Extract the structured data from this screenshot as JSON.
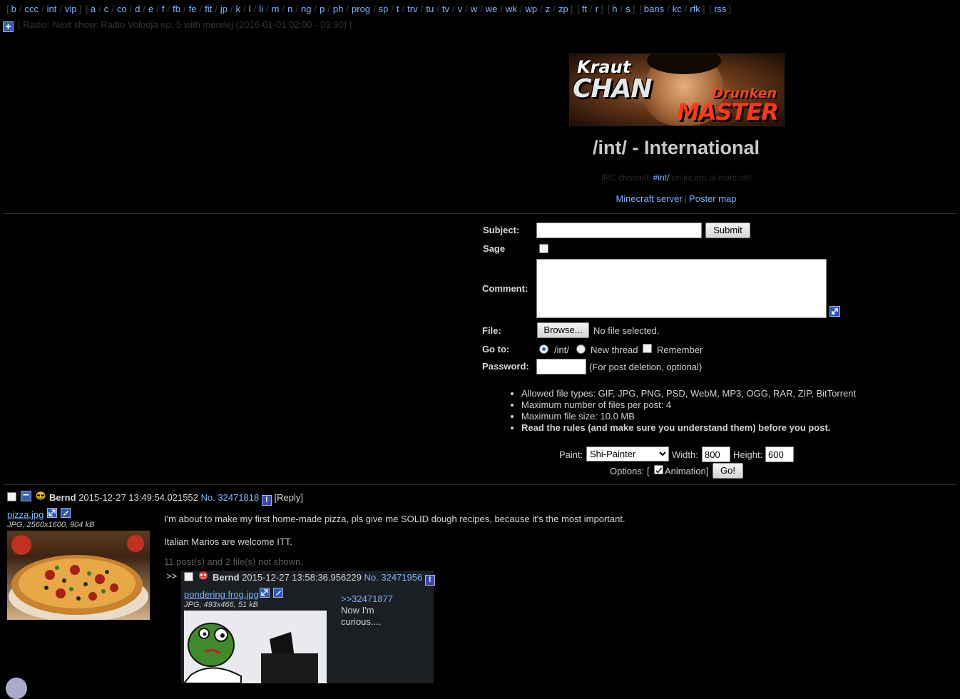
{
  "nav": {
    "group1": [
      "b",
      "ccc",
      "int",
      "vip"
    ],
    "group2": [
      "a",
      "c",
      "co",
      "d",
      "e",
      "f",
      "fb",
      "fe",
      "fit",
      "jp",
      "k",
      "l",
      "li",
      "m",
      "n",
      "ng",
      "p",
      "ph",
      "prog",
      "sp",
      "t",
      "trv",
      "tu",
      "tv",
      "v",
      "w",
      "we",
      "wk",
      "wp",
      "z",
      "zp"
    ],
    "group3": [
      "ft",
      "r"
    ],
    "group4": [
      "h",
      "s"
    ],
    "group5": [
      "bans",
      "kc",
      "rfk"
    ],
    "group6": [
      "rss"
    ]
  },
  "radio": {
    "text": "[ Radio: Next show: Radio Volodja ep. 5 with merelej (2016-01-01 02:00 - 03:30) ]"
  },
  "banner": {
    "line1": "Kraut",
    "line2": "CHAN",
    "line3": "Drunken",
    "line4": "MASTER"
  },
  "board": {
    "title": "/int/ - International",
    "irc_prefix": "IRC channel:",
    "irc_channel": "#int/",
    "irc_suffix": "on irc.inn.at.euirc.net",
    "link_minecraft": "Minecraft server",
    "link_postermap": "Poster map"
  },
  "form": {
    "subject_label": "Subject:",
    "submit_label": "Submit",
    "sage_label": "Sage",
    "comment_label": "Comment:",
    "file_label": "File:",
    "browse_label": "Browse...",
    "no_file": "No file selected.",
    "goto_label": "Go to:",
    "goto_board": "/int/",
    "goto_thread": "New thread",
    "remember_label": "Remember",
    "password_label": "Password:",
    "password_hint": "(For post deletion, optional)",
    "rules": [
      "Allowed file types: GIF, JPG, PNG, PSD, WebM, MP3, OGG, RAR, ZIP, BitTorrent",
      "Maximum number of files per post: 4",
      "Maximum file size: 10.0 MB",
      "Read the rules (and make sure you understand them) before you post."
    ]
  },
  "paint": {
    "paint_label": "Paint:",
    "painter": "Shi-Painter",
    "width_label": "Width:",
    "width_value": "800",
    "height_label": "Height:",
    "height_value": "600",
    "options_prefix": "Options: [",
    "animation_label": "Animation]",
    "go_label": "Go!"
  },
  "thread": {
    "op": {
      "name": "Bernd",
      "datetime": "2015-12-27 13:49:54.021552",
      "no_label": "No.",
      "no": "32471818",
      "reply_link": "[Reply]",
      "filename": "pizza.jpg",
      "fileinfo": "JPG, 2560x1600, 904 kB",
      "message_line1": "I'm about to make my first home-made pizza, pls give me SOLID dough recipes, because it's the most important.",
      "message_line2": "Italian Marios are welcome ITT.",
      "omitted": "11 post(s) and 2 file(s) not shown."
    },
    "reply": {
      "arrow": ">>",
      "name": "Bernd",
      "datetime": "2015-12-27 13:58:36.956229",
      "no_label": "No.",
      "no": "32471956",
      "filename": "pondering frog.jpg",
      "fileinfo": "JPG, 493x466, 51 kB",
      "quote": ">>32471877",
      "message_line1": "Now I'm",
      "message_line2": "curious...."
    }
  }
}
